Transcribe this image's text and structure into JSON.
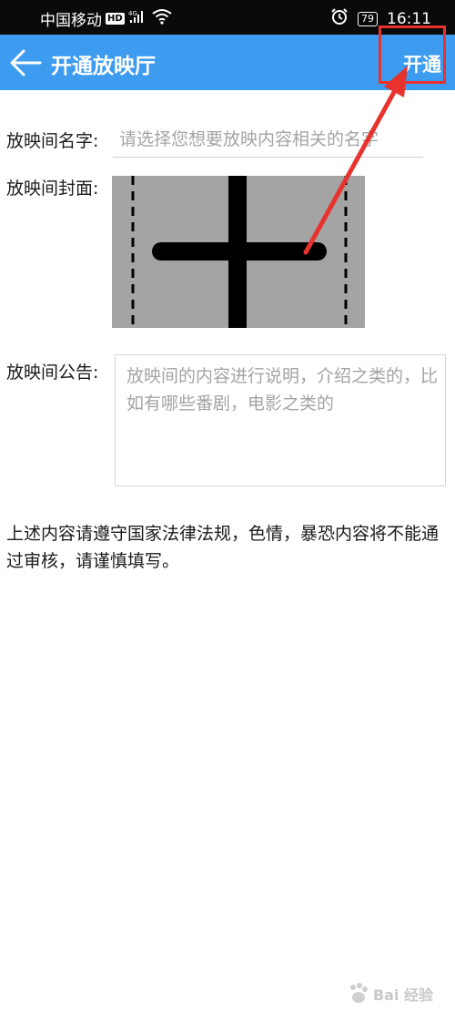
{
  "status_bar": {
    "carrier": "中国移动",
    "network_badge": "HD",
    "signal_type": "4G",
    "battery": "79",
    "time": "16:11"
  },
  "header": {
    "title": "开通放映厅",
    "open_button": "开通",
    "back_icon": "arrow-left-icon"
  },
  "form": {
    "name_label": "放映间名字:",
    "name_placeholder": "请选择您想要放映内容相关的名字",
    "cover_label": "放映间封面:",
    "cover_icon": "plus-icon",
    "notice_label": "放映间公告:",
    "notice_placeholder": "放映间的内容进行说明，介绍之类的，比如有哪些番剧，电影之类的"
  },
  "rules_text": "上述内容请遵守国家法律法规，色情，暴恐内容将不能通过审核，请谨慎填写。",
  "watermark": "Bai 经验",
  "colors": {
    "header_bg": "#3d9bf0",
    "highlight": "#e8322e",
    "cover_bg": "#a4a4a4"
  }
}
